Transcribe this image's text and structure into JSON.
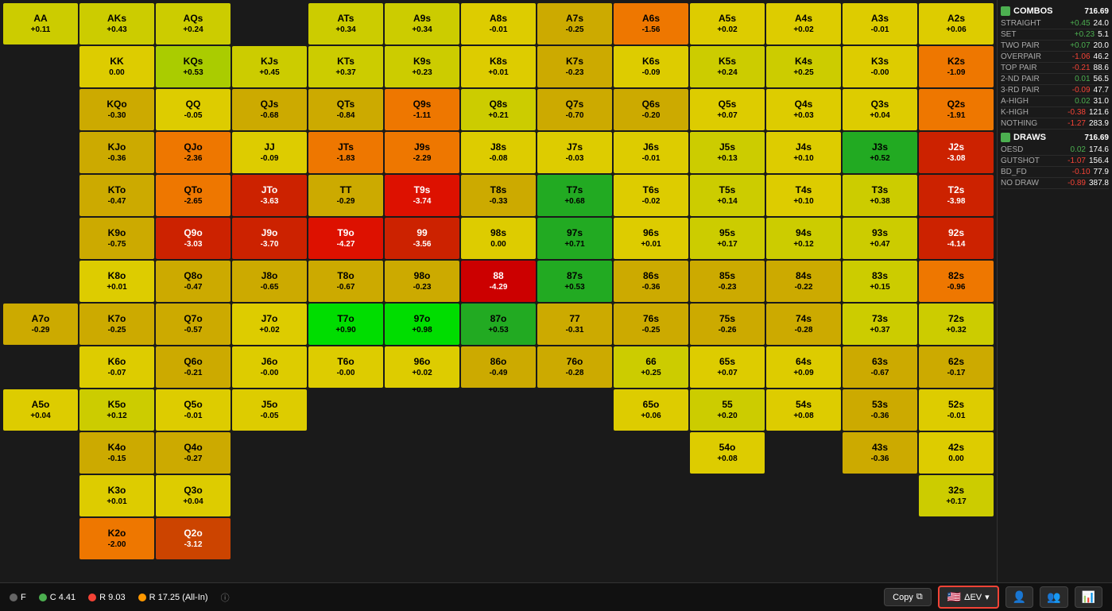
{
  "sidebar": {
    "combos_label": "COMBOS",
    "combos_count": "716.69",
    "straight_label": "STRAIGHT",
    "straight_val1": "+0.45",
    "straight_val2": "24.0",
    "set_label": "SET",
    "set_val1": "+0.23",
    "set_val2": "5.1",
    "two_pair_label": "TWO PAIR",
    "two_pair_val1": "+0.07",
    "two_pair_val2": "20.0",
    "overpair_label": "OVERPAIR",
    "overpair_val1": "-1.06",
    "overpair_val2": "46.2",
    "top_pair_label": "TOP PAIR",
    "top_pair_val1": "-0.21",
    "top_pair_val2": "88.6",
    "2nd_pair_label": "2-ND PAIR",
    "2nd_pair_val1": "0.01",
    "2nd_pair_val2": "56.5",
    "3rd_pair_label": "3-RD PAIR",
    "3rd_pair_val1": "-0.09",
    "3rd_pair_val2": "47.7",
    "a_high_label": "A-HIGH",
    "a_high_val1": "0.02",
    "a_high_val2": "31.0",
    "k_high_label": "K-HIGH",
    "k_high_val1": "-0.38",
    "k_high_val2": "121.6",
    "nothing_label": "NOTHING",
    "nothing_val1": "-1.27",
    "nothing_val2": "283.9",
    "draws_label": "DRAWS",
    "draws_count": "716.69",
    "oesd_label": "OESD",
    "oesd_val1": "0.02",
    "oesd_val2": "174.6",
    "gutshot_label": "GUTSHOT",
    "gutshot_val1": "-1.07",
    "gutshot_val2": "156.4",
    "bd_fd_label": "BD_FD",
    "bd_fd_val1": "-0.10",
    "bd_fd_val2": "77.9",
    "no_draw_label": "NO DRAW",
    "no_draw_val1": "-0.89",
    "no_draw_val2": "387.8"
  },
  "bottom": {
    "f_label": "F",
    "c_label": "C 4.41",
    "r_label": "R 9.03",
    "r2_label": "R 17.25 (All-In)",
    "copy_label": "Copy",
    "dev_label": "ΔEV"
  },
  "cells": [
    {
      "name": "AA",
      "val": "+0.11",
      "color": "c-yellow"
    },
    {
      "name": "AKs",
      "val": "+0.43",
      "color": "c-yellow"
    },
    {
      "name": "AQs",
      "val": "+0.24",
      "color": "c-yellow"
    },
    {
      "name": "",
      "val": "",
      "color": "empty"
    },
    {
      "name": "ATs",
      "val": "+0.34",
      "color": "c-yellow"
    },
    {
      "name": "A9s",
      "val": "+0.34",
      "color": "c-yellow"
    },
    {
      "name": "A8s",
      "val": "-0.01",
      "color": "c-yellow"
    },
    {
      "name": "A7s",
      "val": "-0.25",
      "color": "c-yellow"
    },
    {
      "name": "A6s",
      "val": "-1.56",
      "color": "c-orange"
    },
    {
      "name": "A5s",
      "val": "+0.02",
      "color": "c-yellow"
    },
    {
      "name": "A4s",
      "val": "+0.02",
      "color": "c-yellow"
    },
    {
      "name": "A3s",
      "val": "-0.01",
      "color": "c-yellow"
    },
    {
      "name": "A2s",
      "val": "+0.06",
      "color": "c-yellow"
    },
    {
      "name": "",
      "val": "",
      "color": "empty"
    },
    {
      "name": "KK",
      "val": "0.00",
      "color": "c-yellow"
    },
    {
      "name": "KQs",
      "val": "+0.53",
      "color": "c-yellow"
    },
    {
      "name": "KJs",
      "val": "+0.45",
      "color": "c-yellow"
    },
    {
      "name": "KTs",
      "val": "+0.37",
      "color": "c-yellow"
    },
    {
      "name": "K9s",
      "val": "+0.23",
      "color": "c-yellow"
    },
    {
      "name": "K8s",
      "val": "+0.01",
      "color": "c-yellow"
    },
    {
      "name": "K7s",
      "val": "-0.23",
      "color": "c-yellow"
    },
    {
      "name": "K6s",
      "val": "-0.09",
      "color": "c-yellow"
    },
    {
      "name": "K5s",
      "val": "+0.24",
      "color": "c-yellow"
    },
    {
      "name": "K4s",
      "val": "+0.25",
      "color": "c-yellow"
    },
    {
      "name": "K3s",
      "val": "-0.00",
      "color": "c-yellow"
    },
    {
      "name": "K2s",
      "val": "-1.09",
      "color": "c-orange"
    },
    {
      "name": "",
      "val": "",
      "color": "empty"
    },
    {
      "name": "KQo",
      "val": "-0.30",
      "color": "c-yellow"
    },
    {
      "name": "QQ",
      "val": "-0.05",
      "color": "c-yellow"
    },
    {
      "name": "QJs",
      "val": "-0.68",
      "color": "c-yellow"
    },
    {
      "name": "QTs",
      "val": "-0.84",
      "color": "c-yellow"
    },
    {
      "name": "Q9s",
      "val": "-1.11",
      "color": "c-orange"
    },
    {
      "name": "Q8s",
      "val": "+0.21",
      "color": "c-yellow"
    },
    {
      "name": "Q7s",
      "val": "-0.70",
      "color": "c-yellow"
    },
    {
      "name": "Q6s",
      "val": "-0.20",
      "color": "c-yellow"
    },
    {
      "name": "Q5s",
      "val": "+0.07",
      "color": "c-yellow"
    },
    {
      "name": "Q4s",
      "val": "+0.03",
      "color": "c-yellow"
    },
    {
      "name": "Q3s",
      "val": "+0.04",
      "color": "c-yellow"
    },
    {
      "name": "Q2s",
      "val": "-1.91",
      "color": "c-orange"
    },
    {
      "name": "",
      "val": "",
      "color": "empty"
    },
    {
      "name": "KJo",
      "val": "-0.36",
      "color": "c-yellow"
    },
    {
      "name": "QJo",
      "val": "-2.36",
      "color": "c-orange"
    },
    {
      "name": "JJ",
      "val": "-0.09",
      "color": "c-yellow"
    },
    {
      "name": "JTs",
      "val": "-1.83",
      "color": "c-orange"
    },
    {
      "name": "J9s",
      "val": "-2.29",
      "color": "c-orange"
    },
    {
      "name": "J8s",
      "val": "-0.08",
      "color": "c-yellow"
    },
    {
      "name": "J7s",
      "val": "-0.03",
      "color": "c-yellow"
    },
    {
      "name": "J6s",
      "val": "-0.01",
      "color": "c-yellow"
    },
    {
      "name": "J5s",
      "val": "+0.13",
      "color": "c-yellow"
    },
    {
      "name": "J4s",
      "val": "+0.10",
      "color": "c-yellow"
    },
    {
      "name": "J3s",
      "val": "+0.52",
      "color": "c-green"
    },
    {
      "name": "J2s",
      "val": "-3.08",
      "color": "c-red"
    },
    {
      "name": "",
      "val": "",
      "color": "empty"
    },
    {
      "name": "KTo",
      "val": "-0.47",
      "color": "c-yellow"
    },
    {
      "name": "QTo",
      "val": "-2.65",
      "color": "c-orange"
    },
    {
      "name": "JTo",
      "val": "-3.63",
      "color": "c-red"
    },
    {
      "name": "TT",
      "val": "-0.29",
      "color": "c-yellow"
    },
    {
      "name": "T9s",
      "val": "-3.74",
      "color": "c-red"
    },
    {
      "name": "T8s",
      "val": "-0.33",
      "color": "c-yellow"
    },
    {
      "name": "T7s",
      "val": "+0.68",
      "color": "c-green"
    },
    {
      "name": "T6s",
      "val": "-0.02",
      "color": "c-yellow"
    },
    {
      "name": "T5s",
      "val": "+0.14",
      "color": "c-yellow"
    },
    {
      "name": "T4s",
      "val": "+0.10",
      "color": "c-yellow"
    },
    {
      "name": "T3s",
      "val": "+0.38",
      "color": "c-yellow"
    },
    {
      "name": "T2s",
      "val": "-3.98",
      "color": "c-red"
    },
    {
      "name": "",
      "val": "",
      "color": "empty"
    },
    {
      "name": "K9o",
      "val": "-0.75",
      "color": "c-yellow"
    },
    {
      "name": "Q9o",
      "val": "-3.03",
      "color": "c-red"
    },
    {
      "name": "J9o",
      "val": "-3.70",
      "color": "c-red"
    },
    {
      "name": "T9o",
      "val": "-4.27",
      "color": "c-red"
    },
    {
      "name": "99",
      "val": "-3.56",
      "color": "c-red"
    },
    {
      "name": "98s",
      "val": "0.00",
      "color": "c-yellow"
    },
    {
      "name": "97s",
      "val": "+0.71",
      "color": "c-green"
    },
    {
      "name": "96s",
      "val": "+0.01",
      "color": "c-yellow"
    },
    {
      "name": "95s",
      "val": "+0.17",
      "color": "c-yellow"
    },
    {
      "name": "94s",
      "val": "+0.12",
      "color": "c-yellow"
    },
    {
      "name": "93s",
      "val": "+0.47",
      "color": "c-yellow"
    },
    {
      "name": "92s",
      "val": "-4.14",
      "color": "c-red"
    },
    {
      "name": "",
      "val": "",
      "color": "empty"
    },
    {
      "name": "K8o",
      "val": "+0.01",
      "color": "c-yellow"
    },
    {
      "name": "Q8o",
      "val": "-0.47",
      "color": "c-yellow"
    },
    {
      "name": "J8o",
      "val": "-0.65",
      "color": "c-yellow"
    },
    {
      "name": "T8o",
      "val": "-0.67",
      "color": "c-yellow"
    },
    {
      "name": "98o",
      "val": "-0.23",
      "color": "c-yellow"
    },
    {
      "name": "88",
      "val": "-4.29",
      "color": "c-red"
    },
    {
      "name": "87s",
      "val": "+0.53",
      "color": "c-green"
    },
    {
      "name": "86s",
      "val": "-0.36",
      "color": "c-yellow"
    },
    {
      "name": "85s",
      "val": "-0.23",
      "color": "c-yellow"
    },
    {
      "name": "84s",
      "val": "-0.22",
      "color": "c-yellow"
    },
    {
      "name": "83s",
      "val": "+0.15",
      "color": "c-yellow"
    },
    {
      "name": "82s",
      "val": "-0.96",
      "color": "c-orange"
    },
    {
      "name": "A7o",
      "val": "-0.29",
      "color": "c-yellow"
    },
    {
      "name": "K7o",
      "val": "-0.25",
      "color": "c-yellow"
    },
    {
      "name": "Q7o",
      "val": "-0.57",
      "color": "c-yellow"
    },
    {
      "name": "J7o",
      "val": "+0.02",
      "color": "c-yellow"
    },
    {
      "name": "T7o",
      "val": "+0.90",
      "color": "c-green-bright"
    },
    {
      "name": "97o",
      "val": "+0.98",
      "color": "c-green-bright"
    },
    {
      "name": "87o",
      "val": "+0.53",
      "color": "c-green"
    },
    {
      "name": "77",
      "val": "-0.31",
      "color": "c-yellow"
    },
    {
      "name": "76s",
      "val": "-0.25",
      "color": "c-yellow"
    },
    {
      "name": "75s",
      "val": "-0.26",
      "color": "c-yellow"
    },
    {
      "name": "74s",
      "val": "-0.28",
      "color": "c-yellow"
    },
    {
      "name": "73s",
      "val": "+0.37",
      "color": "c-yellow"
    },
    {
      "name": "72s",
      "val": "+0.32",
      "color": "c-yellow"
    },
    {
      "name": "",
      "val": "",
      "color": "empty"
    },
    {
      "name": "K6o",
      "val": "-0.07",
      "color": "c-yellow"
    },
    {
      "name": "Q6o",
      "val": "-0.21",
      "color": "c-yellow"
    },
    {
      "name": "J6o",
      "val": "-0.00",
      "color": "c-yellow"
    },
    {
      "name": "T6o",
      "val": "-0.00",
      "color": "c-yellow"
    },
    {
      "name": "96o",
      "val": "+0.02",
      "color": "c-yellow"
    },
    {
      "name": "86o",
      "val": "-0.49",
      "color": "c-yellow"
    },
    {
      "name": "76o",
      "val": "-0.28",
      "color": "c-yellow"
    },
    {
      "name": "66",
      "val": "+0.25",
      "color": "c-yellow"
    },
    {
      "name": "65s",
      "val": "+0.07",
      "color": "c-yellow"
    },
    {
      "name": "64s",
      "val": "+0.09",
      "color": "c-yellow"
    },
    {
      "name": "63s",
      "val": "-0.67",
      "color": "c-yellow"
    },
    {
      "name": "62s",
      "val": "-0.17",
      "color": "c-yellow"
    },
    {
      "name": "A5o",
      "val": "+0.04",
      "color": "c-yellow"
    },
    {
      "name": "K5o",
      "val": "+0.12",
      "color": "c-yellow"
    },
    {
      "name": "Q5o",
      "val": "-0.01",
      "color": "c-yellow"
    },
    {
      "name": "J5o",
      "val": "-0.05",
      "color": "c-yellow"
    },
    {
      "name": "",
      "val": "",
      "color": "empty"
    },
    {
      "name": "",
      "val": "",
      "color": "empty"
    },
    {
      "name": "",
      "val": "",
      "color": "empty"
    },
    {
      "name": "",
      "val": "",
      "color": "empty"
    },
    {
      "name": "65o",
      "val": "+0.06",
      "color": "c-yellow"
    },
    {
      "name": "55",
      "val": "+0.20",
      "color": "c-yellow"
    },
    {
      "name": "54s",
      "val": "+0.08",
      "color": "c-yellow"
    },
    {
      "name": "53s",
      "val": "-0.36",
      "color": "c-yellow"
    },
    {
      "name": "52s",
      "val": "-0.01",
      "color": "c-yellow"
    },
    {
      "name": "",
      "val": "",
      "color": "empty"
    },
    {
      "name": "K4o",
      "val": "-0.15",
      "color": "c-yellow"
    },
    {
      "name": "Q4o",
      "val": "-0.27",
      "color": "c-yellow"
    },
    {
      "name": "",
      "val": "",
      "color": "empty"
    },
    {
      "name": "",
      "val": "",
      "color": "empty"
    },
    {
      "name": "",
      "val": "",
      "color": "empty"
    },
    {
      "name": "",
      "val": "",
      "color": "empty"
    },
    {
      "name": "",
      "val": "",
      "color": "empty"
    },
    {
      "name": "",
      "val": "",
      "color": "empty"
    },
    {
      "name": "54o",
      "val": "+0.08",
      "color": "c-yellow"
    },
    {
      "name": "",
      "val": "",
      "color": "empty"
    },
    {
      "name": "43s",
      "val": "-0.36",
      "color": "c-yellow"
    },
    {
      "name": "42s",
      "val": "0.00",
      "color": "c-yellow"
    },
    {
      "name": "",
      "val": "",
      "color": "empty"
    },
    {
      "name": "K3o",
      "val": "+0.01",
      "color": "c-yellow"
    },
    {
      "name": "Q3o",
      "val": "+0.04",
      "color": "c-yellow"
    },
    {
      "name": "",
      "val": "",
      "color": "empty"
    },
    {
      "name": "",
      "val": "",
      "color": "empty"
    },
    {
      "name": "",
      "val": "",
      "color": "empty"
    },
    {
      "name": "",
      "val": "",
      "color": "empty"
    },
    {
      "name": "",
      "val": "",
      "color": "empty"
    },
    {
      "name": "",
      "val": "",
      "color": "empty"
    },
    {
      "name": "",
      "val": "",
      "color": "empty"
    },
    {
      "name": "",
      "val": "",
      "color": "empty"
    },
    {
      "name": "",
      "val": "",
      "color": "empty"
    },
    {
      "name": "32s",
      "val": "+0.17",
      "color": "c-yellow"
    },
    {
      "name": "",
      "val": "",
      "color": "empty"
    },
    {
      "name": "K2o",
      "val": "-2.00",
      "color": "c-orange"
    },
    {
      "name": "Q2o",
      "val": "-3.12",
      "color": "c-deep-orange"
    },
    {
      "name": "",
      "val": "",
      "color": "empty"
    },
    {
      "name": "",
      "val": "",
      "color": "empty"
    },
    {
      "name": "",
      "val": "",
      "color": "empty"
    },
    {
      "name": "",
      "val": "",
      "color": "empty"
    },
    {
      "name": "",
      "val": "",
      "color": "empty"
    },
    {
      "name": "",
      "val": "",
      "color": "empty"
    },
    {
      "name": "",
      "val": "",
      "color": "empty"
    },
    {
      "name": "",
      "val": "",
      "color": "empty"
    },
    {
      "name": "",
      "val": "",
      "color": "empty"
    },
    {
      "name": "",
      "val": "",
      "color": "empty"
    }
  ]
}
